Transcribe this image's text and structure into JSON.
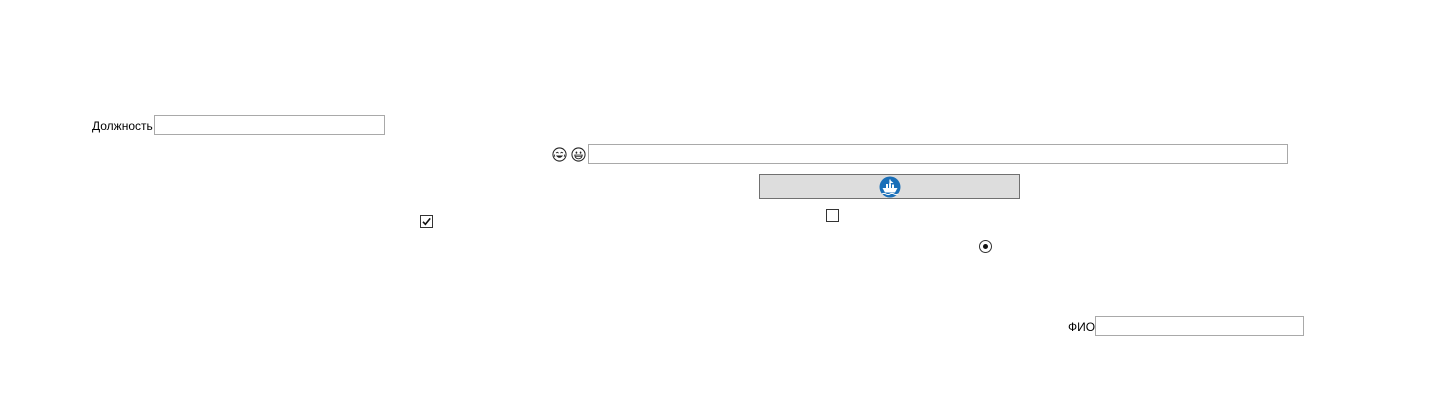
{
  "position_field": {
    "label": "Должность",
    "value": ""
  },
  "search_row": {
    "icon_1": "laughing-face-icon",
    "icon_2": "grinning-face-icon",
    "value": ""
  },
  "image_button": {
    "icon": "blue-ship-icon",
    "accent_color": "#1a6fb8",
    "background_color": "#dddddd"
  },
  "checkbox_1": {
    "checked": true
  },
  "checkbox_2": {
    "checked": false
  },
  "radio_1": {
    "selected": true
  },
  "fio_field": {
    "label": "ФИО",
    "value": ""
  }
}
